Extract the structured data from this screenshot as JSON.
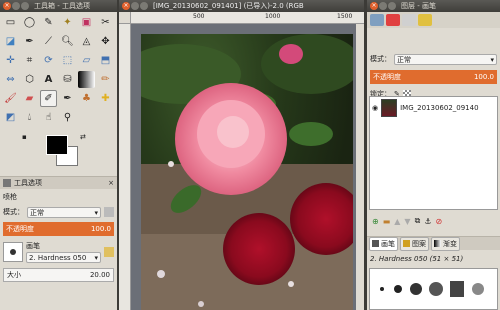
{
  "toolbox": {
    "title": "工具箱 - 工具选项",
    "options_tab": "工具选项",
    "tool_name": "喷枪",
    "mode_label": "模式：",
    "mode_value": "正常",
    "opacity_label": "不透明度",
    "opacity_value": "100.0",
    "brush_label": "画笔",
    "brush_value": "2. Hardness 050",
    "size_label": "大小",
    "size_value": "20.00"
  },
  "image_window": {
    "title": "[IMG_20130602_091401] (已导入)-2.0 (RGB",
    "ruler_marks": [
      "500",
      "1000",
      "1500"
    ]
  },
  "layers": {
    "title": "图层 - 画笔",
    "mode_label": "模式：",
    "mode_value": "正常",
    "opacity_label": "不透明度",
    "opacity_value": "100.0",
    "lock_label": "锁定：",
    "layer_name": "IMG_20130602_09140",
    "brush_tabs": [
      "画笔",
      "图案",
      "渐变"
    ],
    "brush_name": "2. Hardness 050 (51 × 51)"
  },
  "colors": {
    "accent": "#e06c2e",
    "panel": "#dfdbd2",
    "titlebar": "#3f3e3a"
  },
  "chart_data": null
}
